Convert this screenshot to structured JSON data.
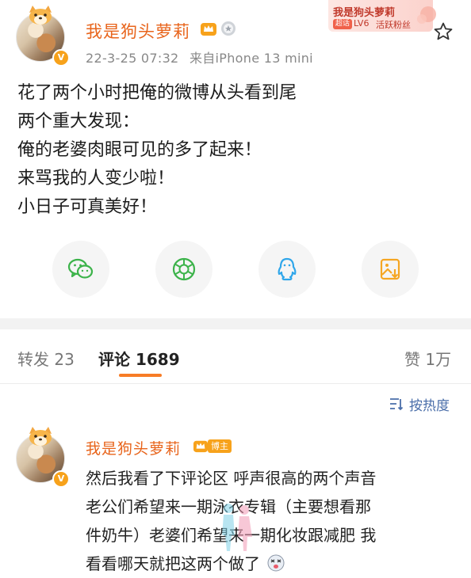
{
  "post": {
    "author": "我是狗头萝莉",
    "time": "22-3-25 07:32",
    "source": "来自iPhone 13 mini",
    "fan_badge": {
      "name": "我是狗头萝莉",
      "tag": "超话",
      "level": "LV6",
      "label": "活跃粉丝"
    },
    "lines": [
      "花了两个小时把俺的微博从头看到尾",
      "两个重大发现：",
      "俺的老婆肉眼可见的多了起来！",
      "来骂我的人变少啦！",
      "小日子可真美好！"
    ]
  },
  "share": [
    "wechat-icon",
    "moments-icon",
    "qq-icon",
    "save-image-icon"
  ],
  "tabs": {
    "repost": "转发 23",
    "comments": "评论 1689",
    "likes": "赞 1万"
  },
  "sort_label": "按热度",
  "comment": {
    "author": "我是狗头萝莉",
    "author_tag": "博主",
    "lines": [
      "然后我看了下评论区 呼声很高的两个声音",
      "老公们希望来一期泳衣专辑（主要想看那",
      "件奶牛）老婆们希望来一期化妆跟减肥 我",
      "看看哪天就把这两个做了"
    ]
  },
  "colors": {
    "accent_orange": "#e8641b",
    "tab_underline": "#f77c26",
    "sort_blue": "#4a6ea9"
  }
}
